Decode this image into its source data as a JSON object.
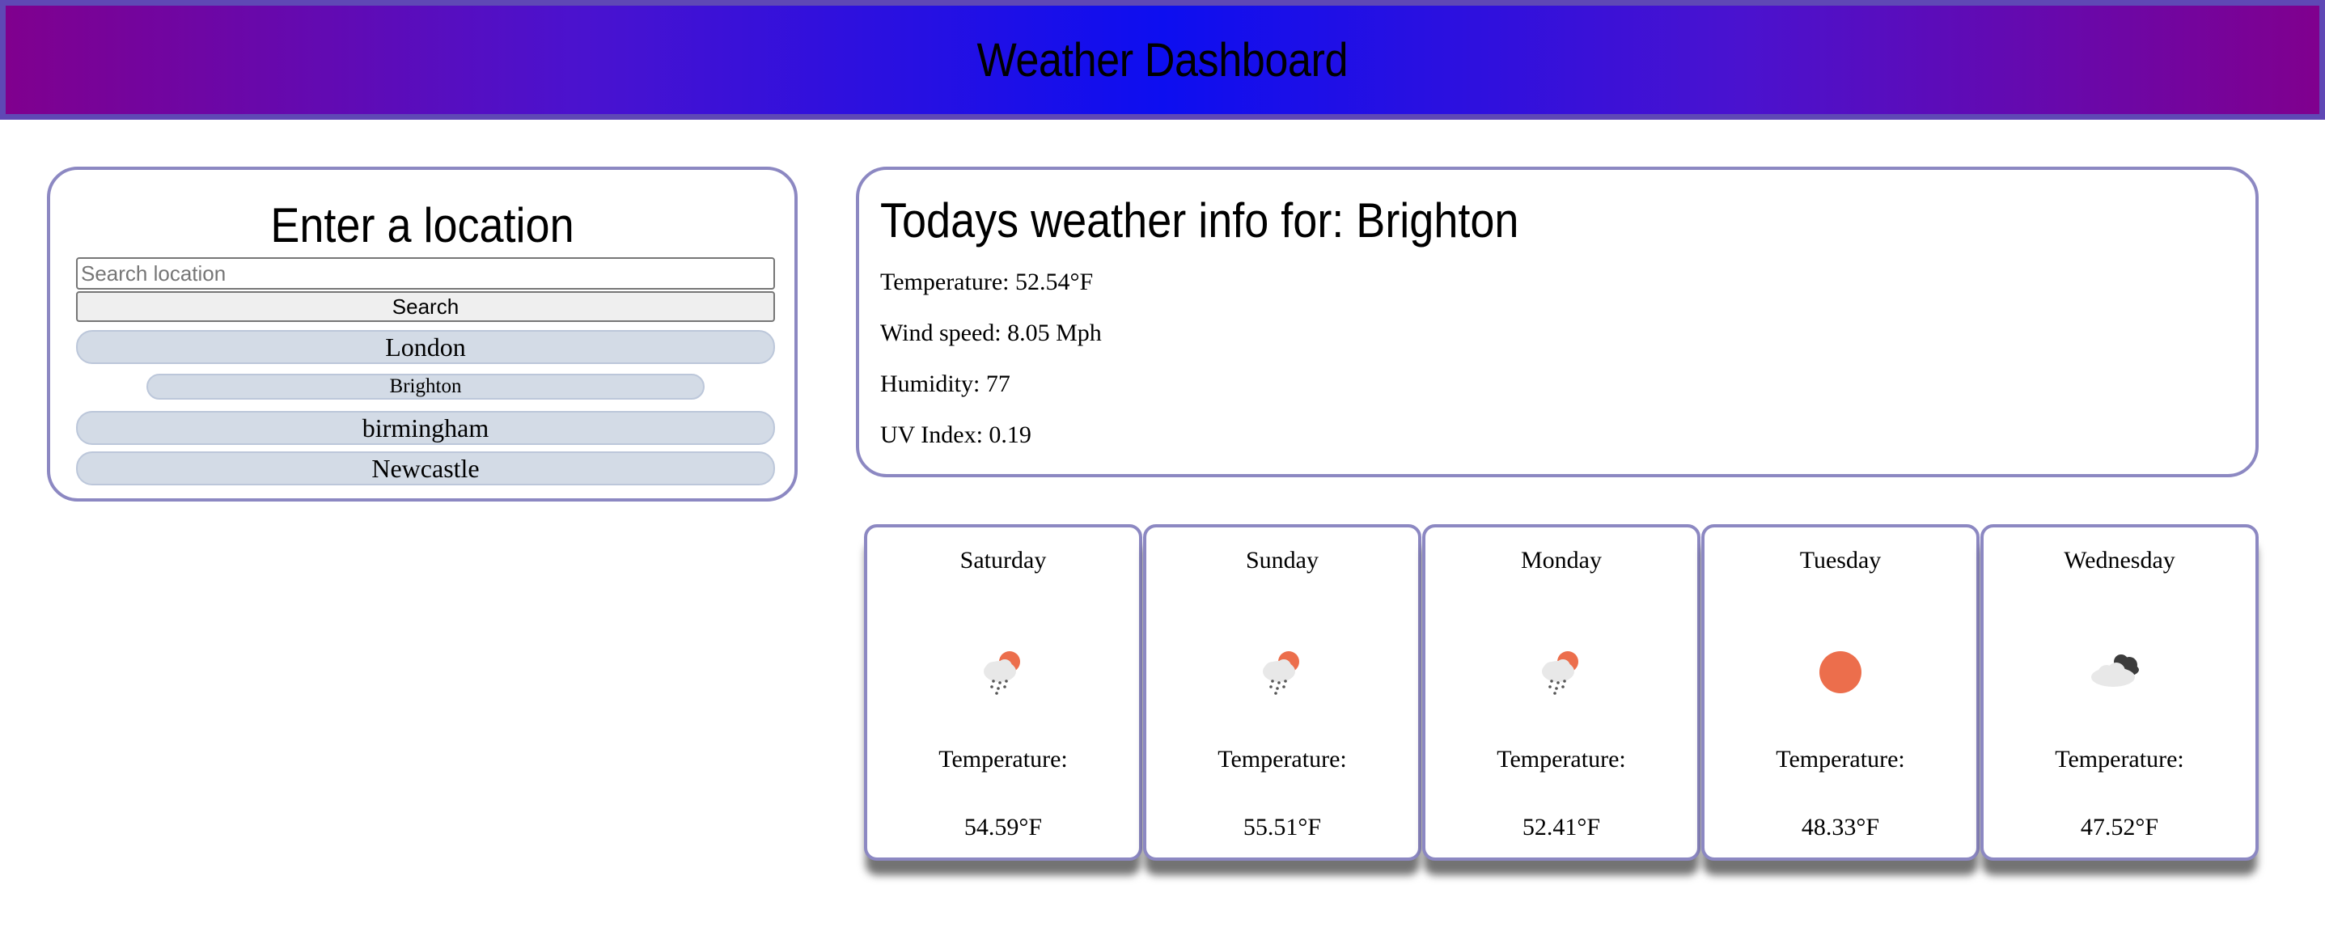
{
  "header": {
    "title": "Weather Dashboard"
  },
  "search": {
    "title": "Enter a location",
    "placeholder": "Search location",
    "button_label": "Search",
    "history": [
      "London",
      "Brighton",
      "birmingham",
      "Newcastle"
    ]
  },
  "today": {
    "title": "Todays weather info for: Brighton",
    "temperature": "Temperature: 52.54°F",
    "wind": "Wind speed: 8.05 Mph",
    "humidity": "Humidity: 77",
    "uv": "UV Index: 0.19"
  },
  "forecast": [
    {
      "day": "Saturday",
      "label": "Temperature:",
      "temp": "54.59°F",
      "icon": "sun-cloud-rain-icon"
    },
    {
      "day": "Sunday",
      "label": "Temperature:",
      "temp": "55.51°F",
      "icon": "sun-cloud-rain-icon"
    },
    {
      "day": "Monday",
      "label": "Temperature:",
      "temp": "52.41°F",
      "icon": "sun-cloud-rain-icon"
    },
    {
      "day": "Tuesday",
      "label": "Temperature:",
      "temp": "48.33°F",
      "icon": "sun-icon"
    },
    {
      "day": "Wednesday",
      "label": "Temperature:",
      "temp": "47.52°F",
      "icon": "broken-clouds-icon"
    }
  ],
  "colors": {
    "panel_border": "#8c88c2",
    "history_button_bg": "#d3dbe6",
    "sun": "#ec6e4c",
    "header_gradient_center": "#0d0ef0",
    "header_gradient_edge": "#80008e"
  }
}
